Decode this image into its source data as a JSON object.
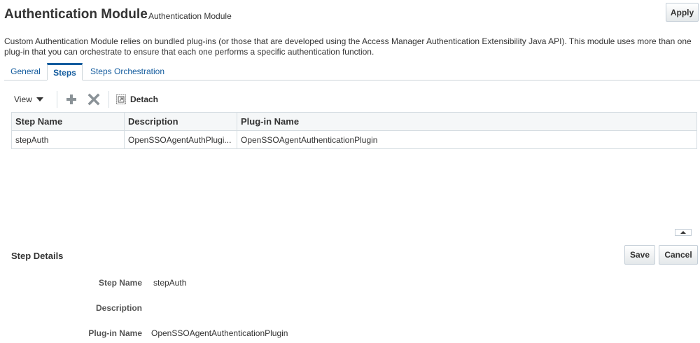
{
  "header": {
    "title": "Authentication Module",
    "subtitle": "Authentication Module",
    "apply_label": "Apply",
    "description": "Custom Authentication Module relies on bundled plug-ins (or those that are developed using the Access Manager Authentication Extensibility Java API). This module uses more than one plug-in that you can orchestrate to ensure that each one performs a specific authentication function."
  },
  "tabs": [
    {
      "label": "General",
      "selected": false
    },
    {
      "label": "Steps",
      "selected": true
    },
    {
      "label": "Steps Orchestration",
      "selected": false
    }
  ],
  "toolbar": {
    "view_label": "View",
    "add_icon": "plus-icon",
    "delete_icon": "x-icon",
    "detach_label": "Detach"
  },
  "table": {
    "columns": [
      "Step Name",
      "Description",
      "Plug-in Name"
    ],
    "rows": [
      [
        "stepAuth",
        "OpenSSOAgentAuthPlugi...",
        "OpenSSOAgentAuthenticationPlugin"
      ]
    ]
  },
  "details": {
    "title": "Step Details",
    "save_label": "Save",
    "cancel_label": "Cancel",
    "fields": [
      {
        "label": "Step Name",
        "value": "stepAuth"
      },
      {
        "label": "Description",
        "value": ""
      },
      {
        "label": "Plug-in Name",
        "value": "OpenSSOAgentAuthenticationPlugin"
      }
    ]
  },
  "colors": {
    "link": "#145c9e",
    "border": "#d6dde2",
    "header_bg": "#f5f7f8"
  }
}
